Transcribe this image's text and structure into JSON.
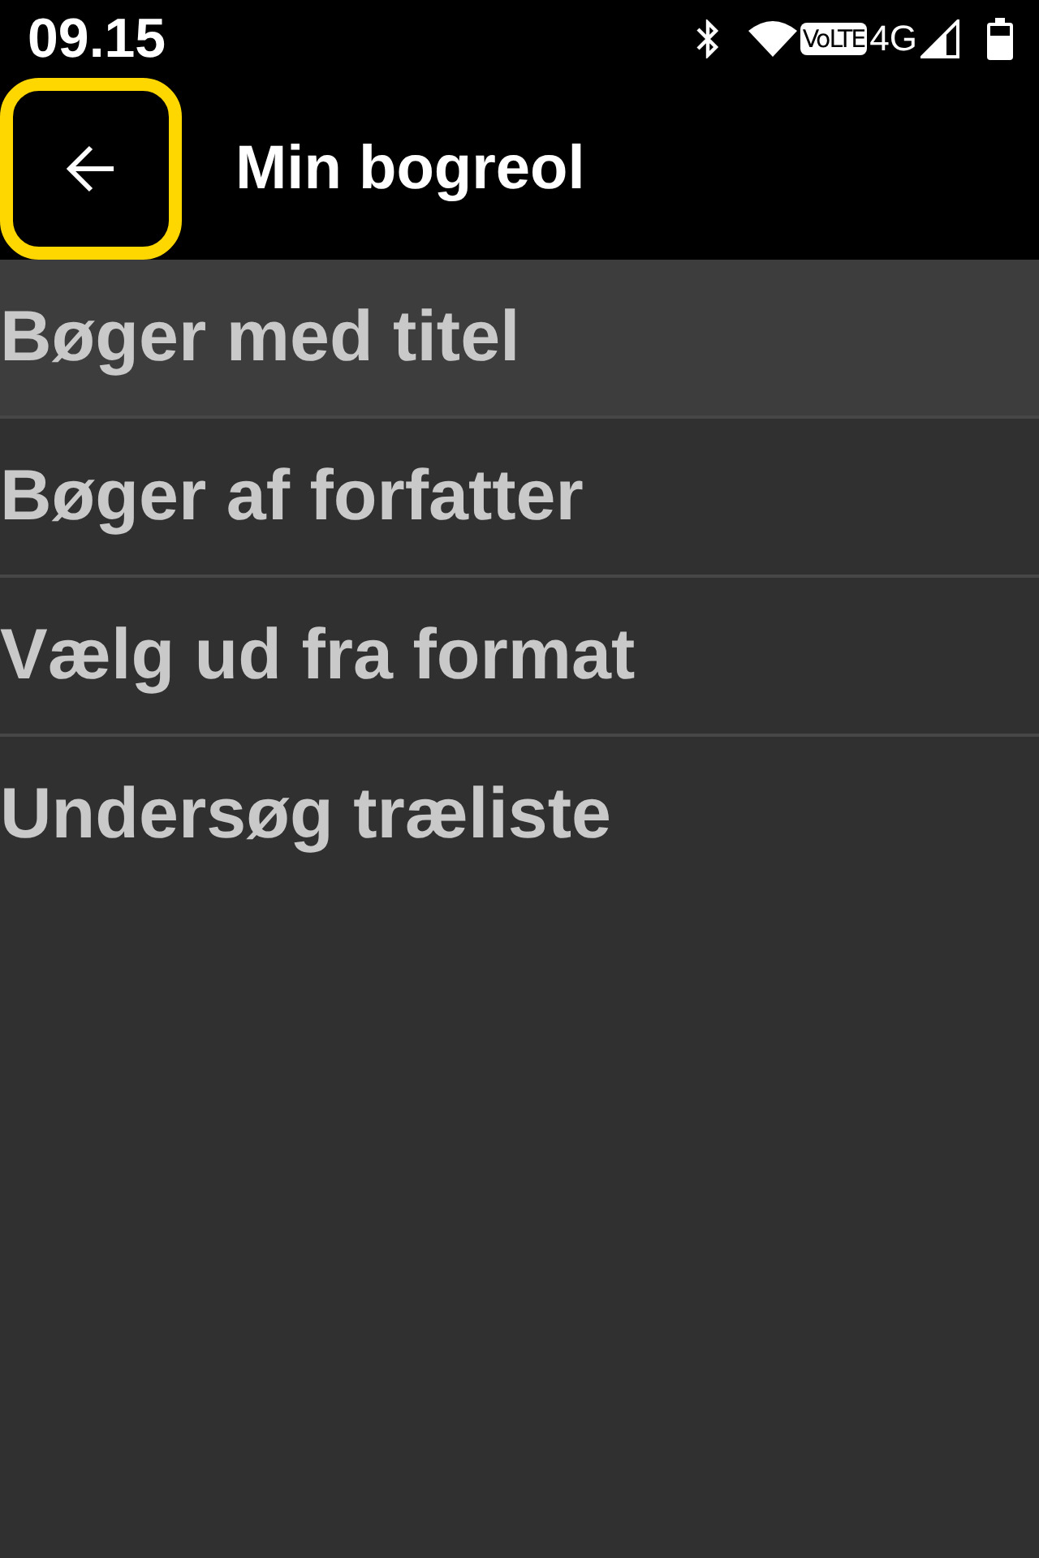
{
  "status_bar": {
    "time": "09.15",
    "volte": "VoLTE",
    "network": "4G"
  },
  "header": {
    "back_button": {
      "focused": true
    },
    "title": "Min bogreol"
  },
  "menu": [
    {
      "label": "Bøger med titel",
      "selected": true
    },
    {
      "label": "Bøger af forfatter",
      "selected": false
    },
    {
      "label": "Vælg ud fra format",
      "selected": false
    },
    {
      "label": "Undersøg træliste",
      "selected": false
    }
  ]
}
